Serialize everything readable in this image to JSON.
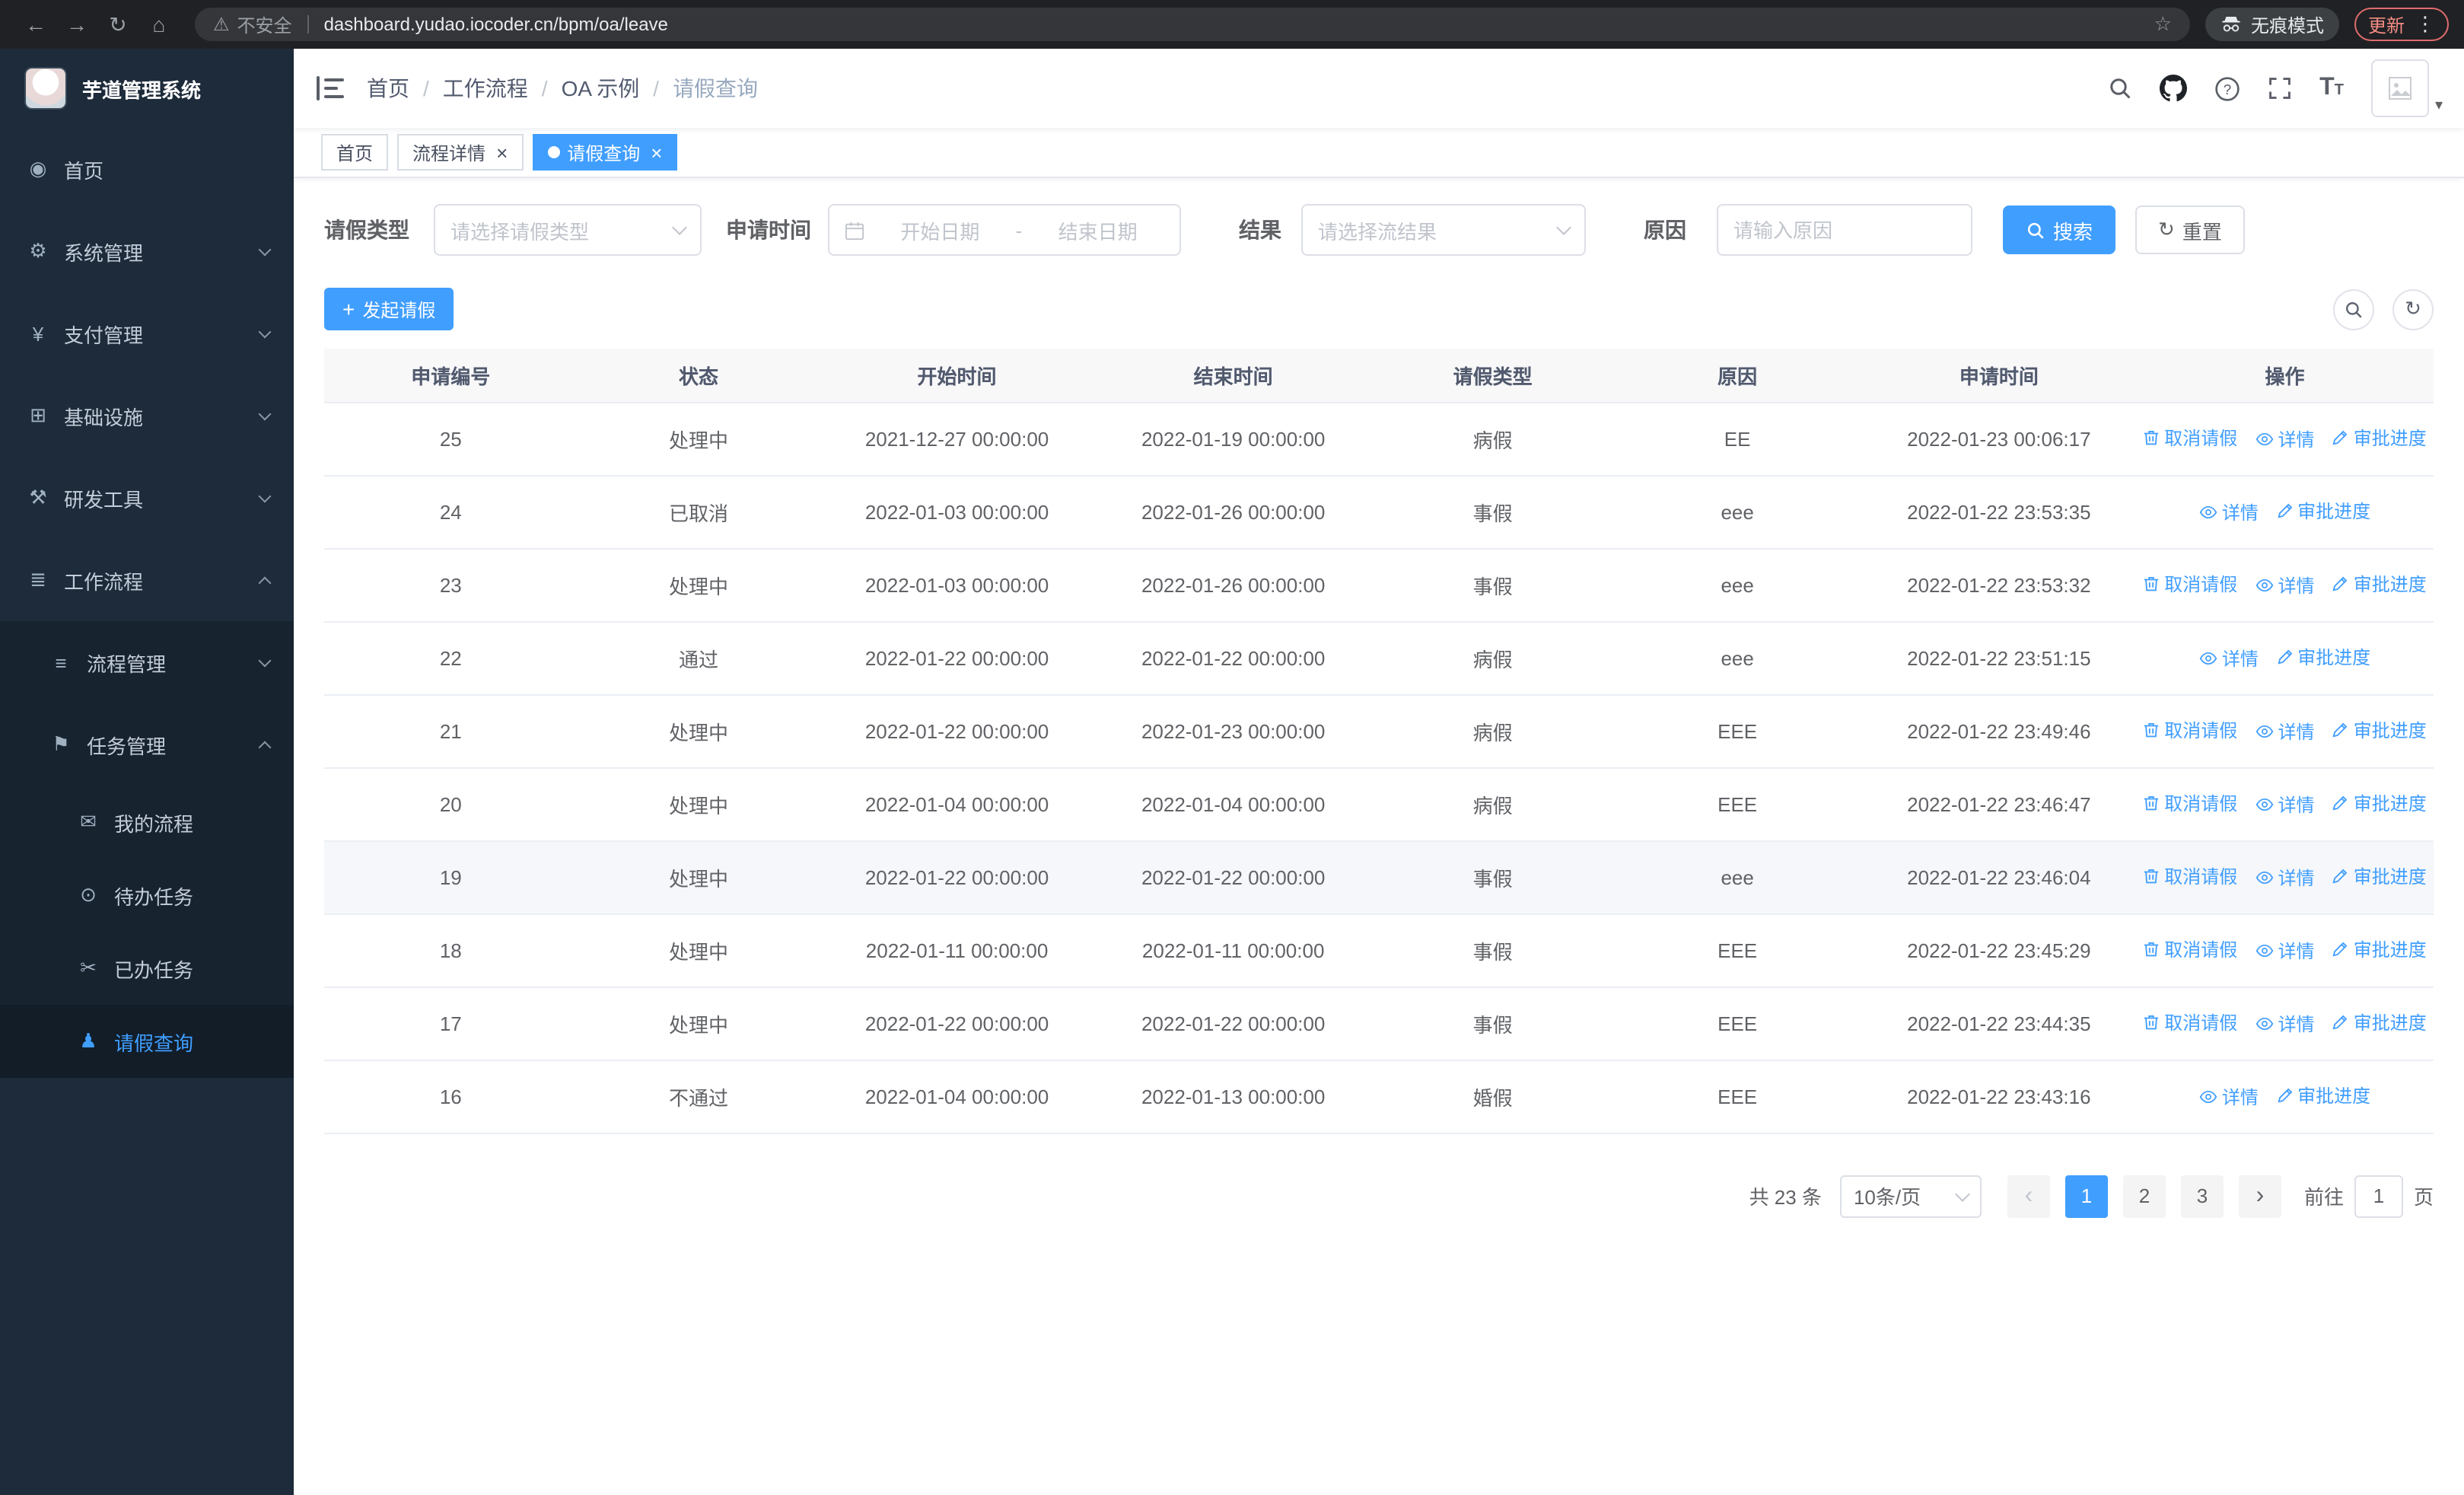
{
  "browser": {
    "back_icon": "←",
    "forward_icon": "→",
    "reload_icon": "↻",
    "home_icon": "⌂",
    "warning_icon": "⚠",
    "security_label": "不安全",
    "url": "dashboard.yudao.iocoder.cn/bpm/oa/leave",
    "star_icon": "☆",
    "incognito_label": "无痕模式",
    "update_label": "更新",
    "menu_icon": "⋮"
  },
  "sidebar": {
    "logo_title": "芋道管理系统",
    "items": [
      {
        "icon": "dashboard-icon",
        "glyph": "◉",
        "label": "首页",
        "cls": "lvl0"
      },
      {
        "icon": "gear-icon",
        "glyph": "⚙",
        "label": "系统管理",
        "cls": "lvl0",
        "chevron": "down"
      },
      {
        "icon": "yen-icon",
        "glyph": "¥",
        "label": "支付管理",
        "cls": "lvl0",
        "chevron": "down"
      },
      {
        "icon": "monitor-icon",
        "glyph": "⊞",
        "label": "基础设施",
        "cls": "lvl0",
        "chevron": "down"
      },
      {
        "icon": "tools-icon",
        "glyph": "⚒",
        "label": "研发工具",
        "cls": "lvl0",
        "chevron": "down"
      },
      {
        "icon": "workflow-icon",
        "glyph": "≣",
        "label": "工作流程",
        "cls": "lvl0",
        "chevron": "up"
      },
      {
        "icon": "list-icon",
        "glyph": "≡",
        "label": "流程管理",
        "cls": "lvl1",
        "sub": true,
        "chevron": "down"
      },
      {
        "icon": "flag-icon",
        "glyph": "⚑",
        "label": "任务管理",
        "cls": "lvl1",
        "sub": true,
        "chevron": "up"
      },
      {
        "icon": "message-icon",
        "glyph": "✉",
        "label": "我的流程",
        "cls": "lvl2",
        "sub": true
      },
      {
        "icon": "eye-icon",
        "glyph": "⊙",
        "label": "待办任务",
        "cls": "lvl2",
        "sub": true
      },
      {
        "icon": "scissors-icon",
        "glyph": "✂",
        "label": "已办任务",
        "cls": "lvl2",
        "sub": true
      },
      {
        "icon": "user-icon",
        "glyph": "♟",
        "label": "请假查询",
        "cls": "lvl2",
        "sub": true,
        "active": true
      }
    ]
  },
  "header": {
    "separator": "/",
    "breadcrumb": [
      "首页",
      "工作流程",
      "OA 示例",
      "请假查询"
    ]
  },
  "tabs": {
    "close_icon": "×",
    "items": [
      {
        "label": "首页"
      },
      {
        "label": "流程详情"
      },
      {
        "label": "请假查询"
      }
    ]
  },
  "filters": {
    "leave_type_label": "请假类型",
    "leave_type_placeholder": "请选择请假类型",
    "apply_time_label": "申请时间",
    "start_placeholder": "开始日期",
    "range_separator": "-",
    "end_placeholder": "结束日期",
    "result_label": "结果",
    "result_placeholder": "请选择流结果",
    "reason_label": "原因",
    "reason_placeholder": "请输入原因",
    "search_label": "搜索",
    "reset_label": "重置"
  },
  "toolbar": {
    "create_label": "发起请假",
    "plus_icon": "+",
    "refresh_icon": "↻"
  },
  "table": {
    "columns": [
      "申请编号",
      "状态",
      "开始时间",
      "结束时间",
      "请假类型",
      "原因",
      "申请时间",
      "操作"
    ],
    "actions": {
      "cancel": "取消请假",
      "detail": "详情",
      "progress": "审批进度"
    },
    "rows": [
      {
        "id": "25",
        "status": "处理中",
        "start": "2021-12-27 00:00:00",
        "end": "2022-01-19 00:00:00",
        "type": "病假",
        "reason": "EE",
        "applied": "2022-01-23 00:06:17",
        "can_cancel": true
      },
      {
        "id": "24",
        "status": "已取消",
        "start": "2022-01-03 00:00:00",
        "end": "2022-01-26 00:00:00",
        "type": "事假",
        "reason": "eee",
        "applied": "2022-01-22 23:53:35",
        "can_cancel": false
      },
      {
        "id": "23",
        "status": "处理中",
        "start": "2022-01-03 00:00:00",
        "end": "2022-01-26 00:00:00",
        "type": "事假",
        "reason": "eee",
        "applied": "2022-01-22 23:53:32",
        "can_cancel": true
      },
      {
        "id": "22",
        "status": "通过",
        "start": "2022-01-22 00:00:00",
        "end": "2022-01-22 00:00:00",
        "type": "病假",
        "reason": "eee",
        "applied": "2022-01-22 23:51:15",
        "can_cancel": false
      },
      {
        "id": "21",
        "status": "处理中",
        "start": "2022-01-22 00:00:00",
        "end": "2022-01-23 00:00:00",
        "type": "病假",
        "reason": "EEE",
        "applied": "2022-01-22 23:49:46",
        "can_cancel": true
      },
      {
        "id": "20",
        "status": "处理中",
        "start": "2022-01-04 00:00:00",
        "end": "2022-01-04 00:00:00",
        "type": "病假",
        "reason": "EEE",
        "applied": "2022-01-22 23:46:47",
        "can_cancel": true
      },
      {
        "id": "19",
        "status": "处理中",
        "start": "2022-01-22 00:00:00",
        "end": "2022-01-22 00:00:00",
        "type": "事假",
        "reason": "eee",
        "applied": "2022-01-22 23:46:04",
        "can_cancel": true,
        "highlighted": true
      },
      {
        "id": "18",
        "status": "处理中",
        "start": "2022-01-11 00:00:00",
        "end": "2022-01-11 00:00:00",
        "type": "事假",
        "reason": "EEE",
        "applied": "2022-01-22 23:45:29",
        "can_cancel": true
      },
      {
        "id": "17",
        "status": "处理中",
        "start": "2022-01-22 00:00:00",
        "end": "2022-01-22 00:00:00",
        "type": "事假",
        "reason": "EEE",
        "applied": "2022-01-22 23:44:35",
        "can_cancel": true
      },
      {
        "id": "16",
        "status": "不通过",
        "start": "2022-01-04 00:00:00",
        "end": "2022-01-13 00:00:00",
        "type": "婚假",
        "reason": "EEE",
        "applied": "2022-01-22 23:43:16",
        "can_cancel": false
      }
    ]
  },
  "pagination": {
    "total_label": "共 23 条",
    "page_size_label": "10条/页",
    "prev_icon": "‹",
    "next_icon": "›",
    "pages": [
      "1",
      "2",
      "3"
    ],
    "goto_label": "前往",
    "goto_value": "1",
    "page_unit": "页"
  },
  "colors": {
    "primary": "#409eff",
    "sidebar_bg": "#1d2b3a",
    "chrome_bg": "#202124"
  }
}
